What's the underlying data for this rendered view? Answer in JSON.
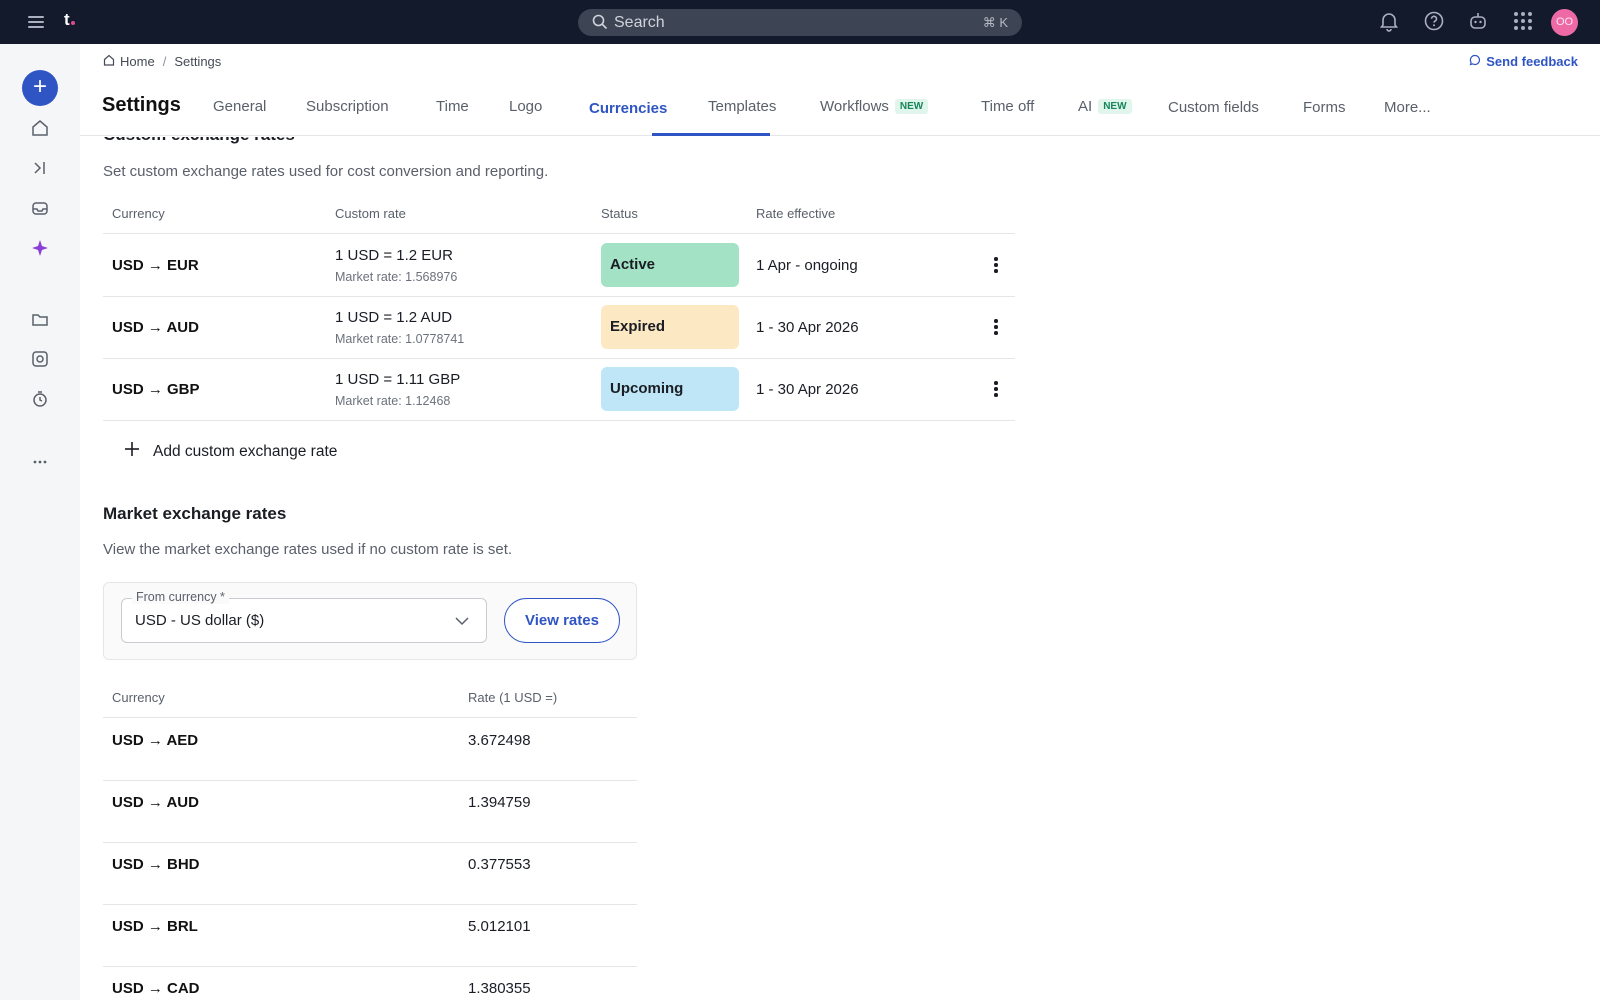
{
  "topbar": {
    "logo_text": "t.",
    "search_placeholder": "Search",
    "search_shortcut": "⌘ K",
    "icons": [
      "menu-icon",
      "bell-icon",
      "help-icon",
      "bot-icon",
      "apps-grid-icon"
    ],
    "avatar_initials": "OO",
    "avatar_color": "#ee6aa6"
  },
  "rail": {
    "add_label": "+",
    "icons": [
      "home-icon",
      "sidebar-expand-icon",
      "inbox-icon",
      "sparkle-icon",
      "folder-icon",
      "camera-icon",
      "timer-icon",
      "more-icon"
    ],
    "accent": "#2f55c4"
  },
  "breadcrumb": {
    "home": "Home",
    "sep": "/",
    "current": "Settings"
  },
  "feedback_label": "Send feedback",
  "page_title": "Settings",
  "tabs": {
    "general": "General",
    "subscription": "Subscription",
    "time": "Time",
    "logo": "Logo",
    "currencies": "Currencies",
    "templates": "Templates",
    "workflows": "Workflows",
    "time_off": "Time off",
    "ai": "AI",
    "custom_fields": "Custom fields",
    "forms": "Forms",
    "more": "More...",
    "new_badge": "NEW",
    "active": "Currencies"
  },
  "custom_rates": {
    "title": "Custom exchange rates",
    "description": "Set custom exchange rates used for cost conversion and reporting.",
    "columns": {
      "currency": "Currency",
      "custom_rate": "Custom rate",
      "status": "Status",
      "rate_effective": "Rate effective"
    },
    "rows": [
      {
        "currency": "USD → EUR",
        "rate": "1 USD = 1.2 EUR",
        "market": "Market rate: 1.568976",
        "status": "Active",
        "effective": "1 Apr - ongoing"
      },
      {
        "currency": "USD → AUD",
        "rate": "1 USD = 1.2 AUD",
        "market": "Market rate: 1.0778741",
        "status": "Expired",
        "effective": "1 - 30 Apr 2026"
      },
      {
        "currency": "USD → GBP",
        "rate": "1 USD = 1.11 GBP",
        "market": "Market rate: 1.12468",
        "status": "Upcoming",
        "effective": "1 - 30 Apr 2026"
      }
    ],
    "add_label": "Add custom exchange rate",
    "status_colors": {
      "Active": "#a3e2c4",
      "Expired": "#fde8c4",
      "Upcoming": "#bfe6f6"
    }
  },
  "market_rates": {
    "title": "Market exchange rates",
    "description": "View the market exchange rates used if no custom rate is set.",
    "from_label": "From currency *",
    "from_value": "USD - US dollar ($)",
    "view_button": "View rates",
    "columns": {
      "currency": "Currency",
      "rate": "Rate (1 USD =)"
    },
    "rows": [
      {
        "currency": "USD → AED",
        "rate": "3.672498"
      },
      {
        "currency": "USD → AUD",
        "rate": "1.394759"
      },
      {
        "currency": "USD → BHD",
        "rate": "0.377553"
      },
      {
        "currency": "USD → BRL",
        "rate": "5.012101"
      },
      {
        "currency": "USD → CAD",
        "rate": "1.380355"
      }
    ]
  }
}
